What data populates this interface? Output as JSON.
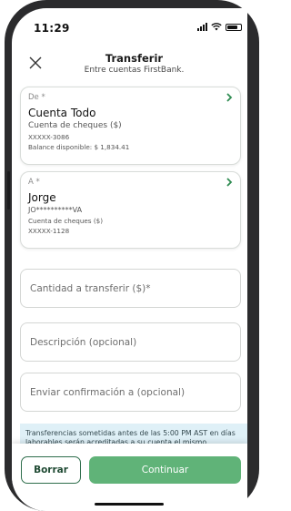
{
  "status_bar": {
    "time": "11:29"
  },
  "header": {
    "title": "Transferir",
    "subtitle": "Entre cuentas FirstBank."
  },
  "from_account": {
    "label": "De *",
    "name": "Cuenta Todo",
    "type": "Cuenta de cheques ($)",
    "number": "XXXXX-3086",
    "balance": "Balance disponible: $ 1,834.41"
  },
  "to_account": {
    "label": "A *",
    "name": "Jorge",
    "masked_id": "JO**********VA",
    "type": "Cuenta de cheques ($)",
    "number": "XXXXX-1128"
  },
  "form": {
    "amount_placeholder": "Cantidad a transferir ($)*",
    "description_placeholder": "Descripción (opcional)",
    "confirmation_placeholder": "Enviar confirmación a (opcional)"
  },
  "notice": {
    "text": "Transferencias sometidas antes de las 5:00 PM AST en días laborables serán acreditadas a su cuenta el mismo"
  },
  "actions": {
    "clear_label": "Borrar",
    "continue_label": "Continuar"
  },
  "colors": {
    "accent_green": "#60b378",
    "dark_green": "#1f4a33",
    "notice_bg": "#dff0f7"
  },
  "icons": {
    "close": "close-icon",
    "chevron": "chevron-right-icon",
    "signal": "signal-icon",
    "wifi": "wifi-icon",
    "battery": "battery-icon"
  }
}
